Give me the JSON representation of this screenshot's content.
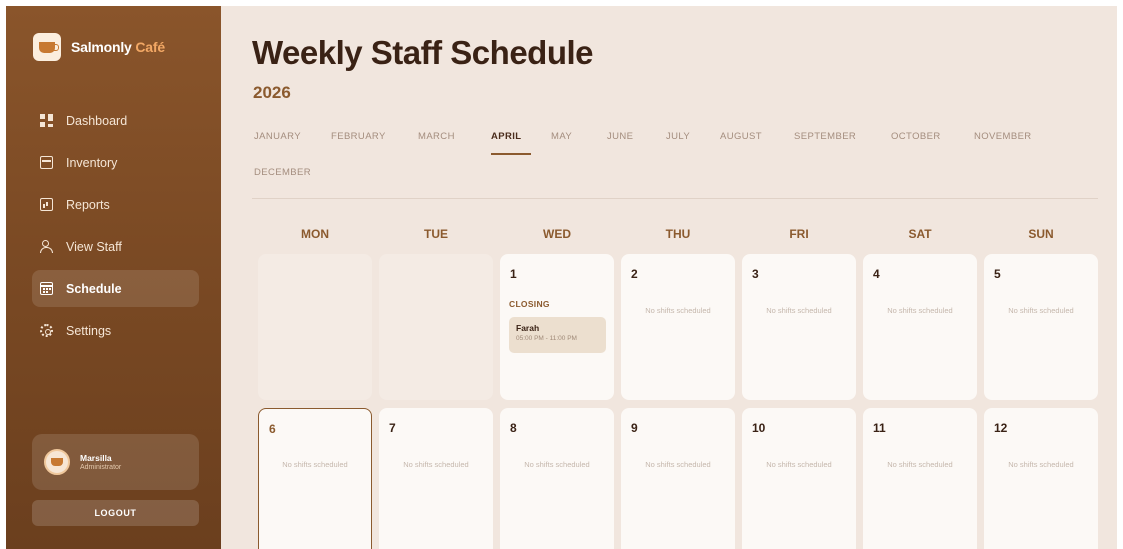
{
  "brand": {
    "name_main": "Salmonly",
    "name_accent": "Café"
  },
  "sidebar": {
    "items": [
      {
        "label": "Dashboard",
        "icon": "dashboard-icon"
      },
      {
        "label": "Inventory",
        "icon": "inventory-icon"
      },
      {
        "label": "Reports",
        "icon": "reports-icon"
      },
      {
        "label": "View Staff",
        "icon": "staff-icon"
      },
      {
        "label": "Schedule",
        "icon": "calendar-icon",
        "active": true
      },
      {
        "label": "Settings",
        "icon": "gear-icon"
      }
    ],
    "user": {
      "name": "Marsilla",
      "role": "Administrator"
    },
    "logout_label": "LOGOUT"
  },
  "header": {
    "title": "Weekly Staff Schedule",
    "year": "2026"
  },
  "months": [
    "JANUARY",
    "FEBRUARY",
    "MARCH",
    "APRIL",
    "MAY",
    "JUNE",
    "JULY",
    "AUGUST",
    "SEPTEMBER",
    "OCTOBER",
    "NOVEMBER",
    "DECEMBER"
  ],
  "selected_month": "APRIL",
  "days": [
    "MON",
    "TUE",
    "WED",
    "THU",
    "FRI",
    "SAT",
    "SUN"
  ],
  "empty_label": "No shifts scheduled",
  "week1": {
    "d1": {
      "date": "1",
      "group": "CLOSING",
      "shift_name": "Farah",
      "shift_time": "05:00 PM - 11:00 PM"
    },
    "d2": {
      "date": "2"
    },
    "d3": {
      "date": "3"
    },
    "d4": {
      "date": "4"
    },
    "d5": {
      "date": "5"
    }
  },
  "week2": {
    "d6": {
      "date": "6"
    },
    "d7": {
      "date": "7"
    },
    "d8": {
      "date": "8"
    },
    "d9": {
      "date": "9"
    },
    "d10": {
      "date": "10"
    },
    "d11": {
      "date": "11"
    },
    "d12": {
      "date": "12"
    }
  },
  "colors": {
    "accent": "#8b5a2e",
    "sidebar": "#7b4a24",
    "background": "#f1e6de"
  }
}
